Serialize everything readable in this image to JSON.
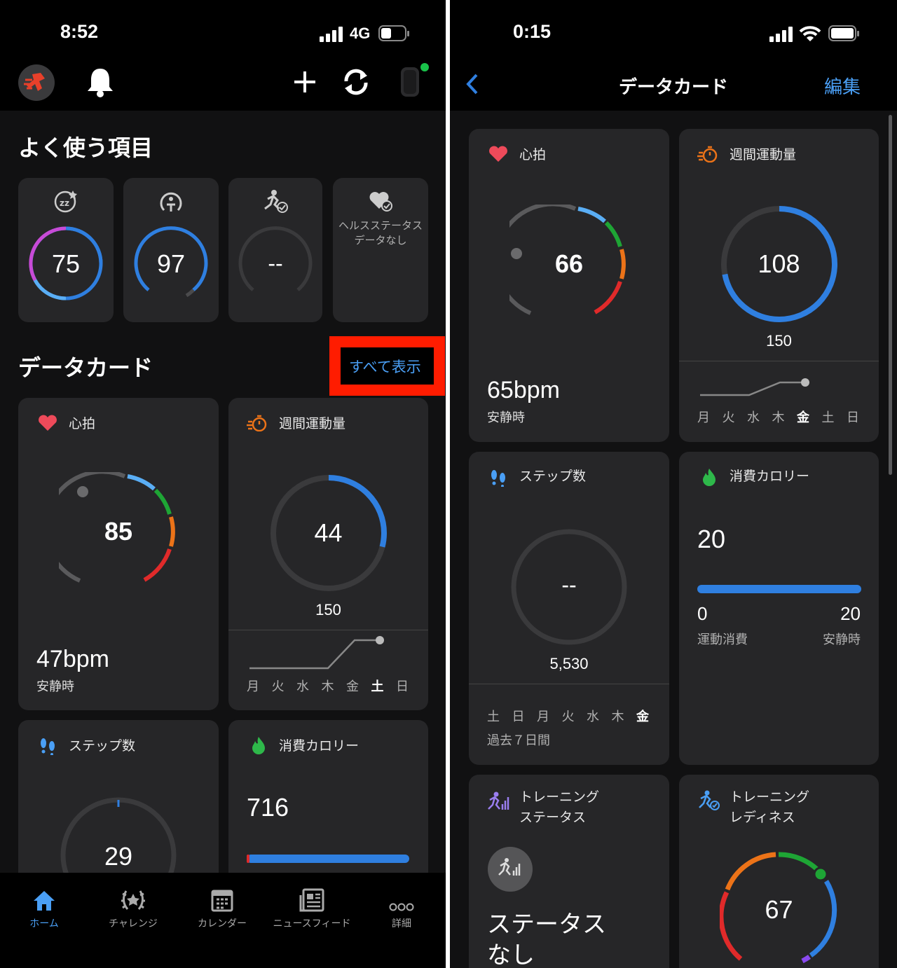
{
  "left": {
    "status": {
      "time": "8:52",
      "network": "4G"
    },
    "section_favorites": "よく使う項目",
    "favorites": [
      {
        "value": "75",
        "icon": "sleep-icon"
      },
      {
        "value": "97",
        "icon": "body-battery-icon"
      },
      {
        "value": "--",
        "icon": "training-readiness-icon"
      },
      {
        "text": "ヘルスステータスデータなし",
        "icon": "health-status-icon"
      }
    ],
    "section_cards": "データカード",
    "show_all": "すべて表示",
    "heart": {
      "title": "心拍",
      "value": "85",
      "bpm": "47bpm",
      "sub": "安静時"
    },
    "weekly": {
      "title": "週間運動量",
      "value": "44",
      "goal": "150",
      "progress": 0.29,
      "days": [
        "月",
        "火",
        "水",
        "木",
        "金",
        "土",
        "日"
      ],
      "current_day": "土"
    },
    "steps": {
      "title": "ステップ数",
      "value": "29"
    },
    "calories": {
      "title": "消費カロリー",
      "value": "716"
    },
    "nav": [
      {
        "label": "ホーム",
        "icon": "home-icon",
        "active": true
      },
      {
        "label": "チャレンジ",
        "icon": "laurel-icon"
      },
      {
        "label": "カレンダー",
        "icon": "calendar-icon"
      },
      {
        "label": "ニュースフィード",
        "icon": "newsfeed-icon"
      },
      {
        "label": "詳細",
        "icon": "more-icon"
      }
    ]
  },
  "right": {
    "status": {
      "time": "0:15"
    },
    "title": "データカード",
    "edit": "編集",
    "heart": {
      "title": "心拍",
      "value": "66",
      "bpm": "65bpm",
      "sub": "安静時"
    },
    "weekly": {
      "title": "週間運動量",
      "value": "108",
      "goal": "150",
      "progress": 0.72,
      "days": [
        "月",
        "火",
        "水",
        "木",
        "金",
        "土",
        "日"
      ],
      "current_day": "金"
    },
    "steps": {
      "title": "ステップ数",
      "value": "--",
      "goal": "5,530",
      "days": [
        "土",
        "日",
        "月",
        "火",
        "水",
        "木",
        "金"
      ],
      "current_day": "金",
      "period": "過去７日間"
    },
    "calories": {
      "title": "消費カロリー",
      "value": "20",
      "active_value": "0",
      "active_label": "運動消費",
      "resting_value": "20",
      "resting_label": "安静時"
    },
    "training_status": {
      "title": "トレーニング\nステータス",
      "status": "ステータス\nなし"
    },
    "training_readiness": {
      "title": "トレーニング\nレディネス",
      "value": "67"
    }
  },
  "colors": {
    "accent": "#2f7fe0",
    "link": "#4a9ff5",
    "red": "#e02a2a",
    "green": "#1ea535",
    "orange": "#ec7318",
    "lightblue": "#5aaef5",
    "gray": "#4a4a4c"
  }
}
